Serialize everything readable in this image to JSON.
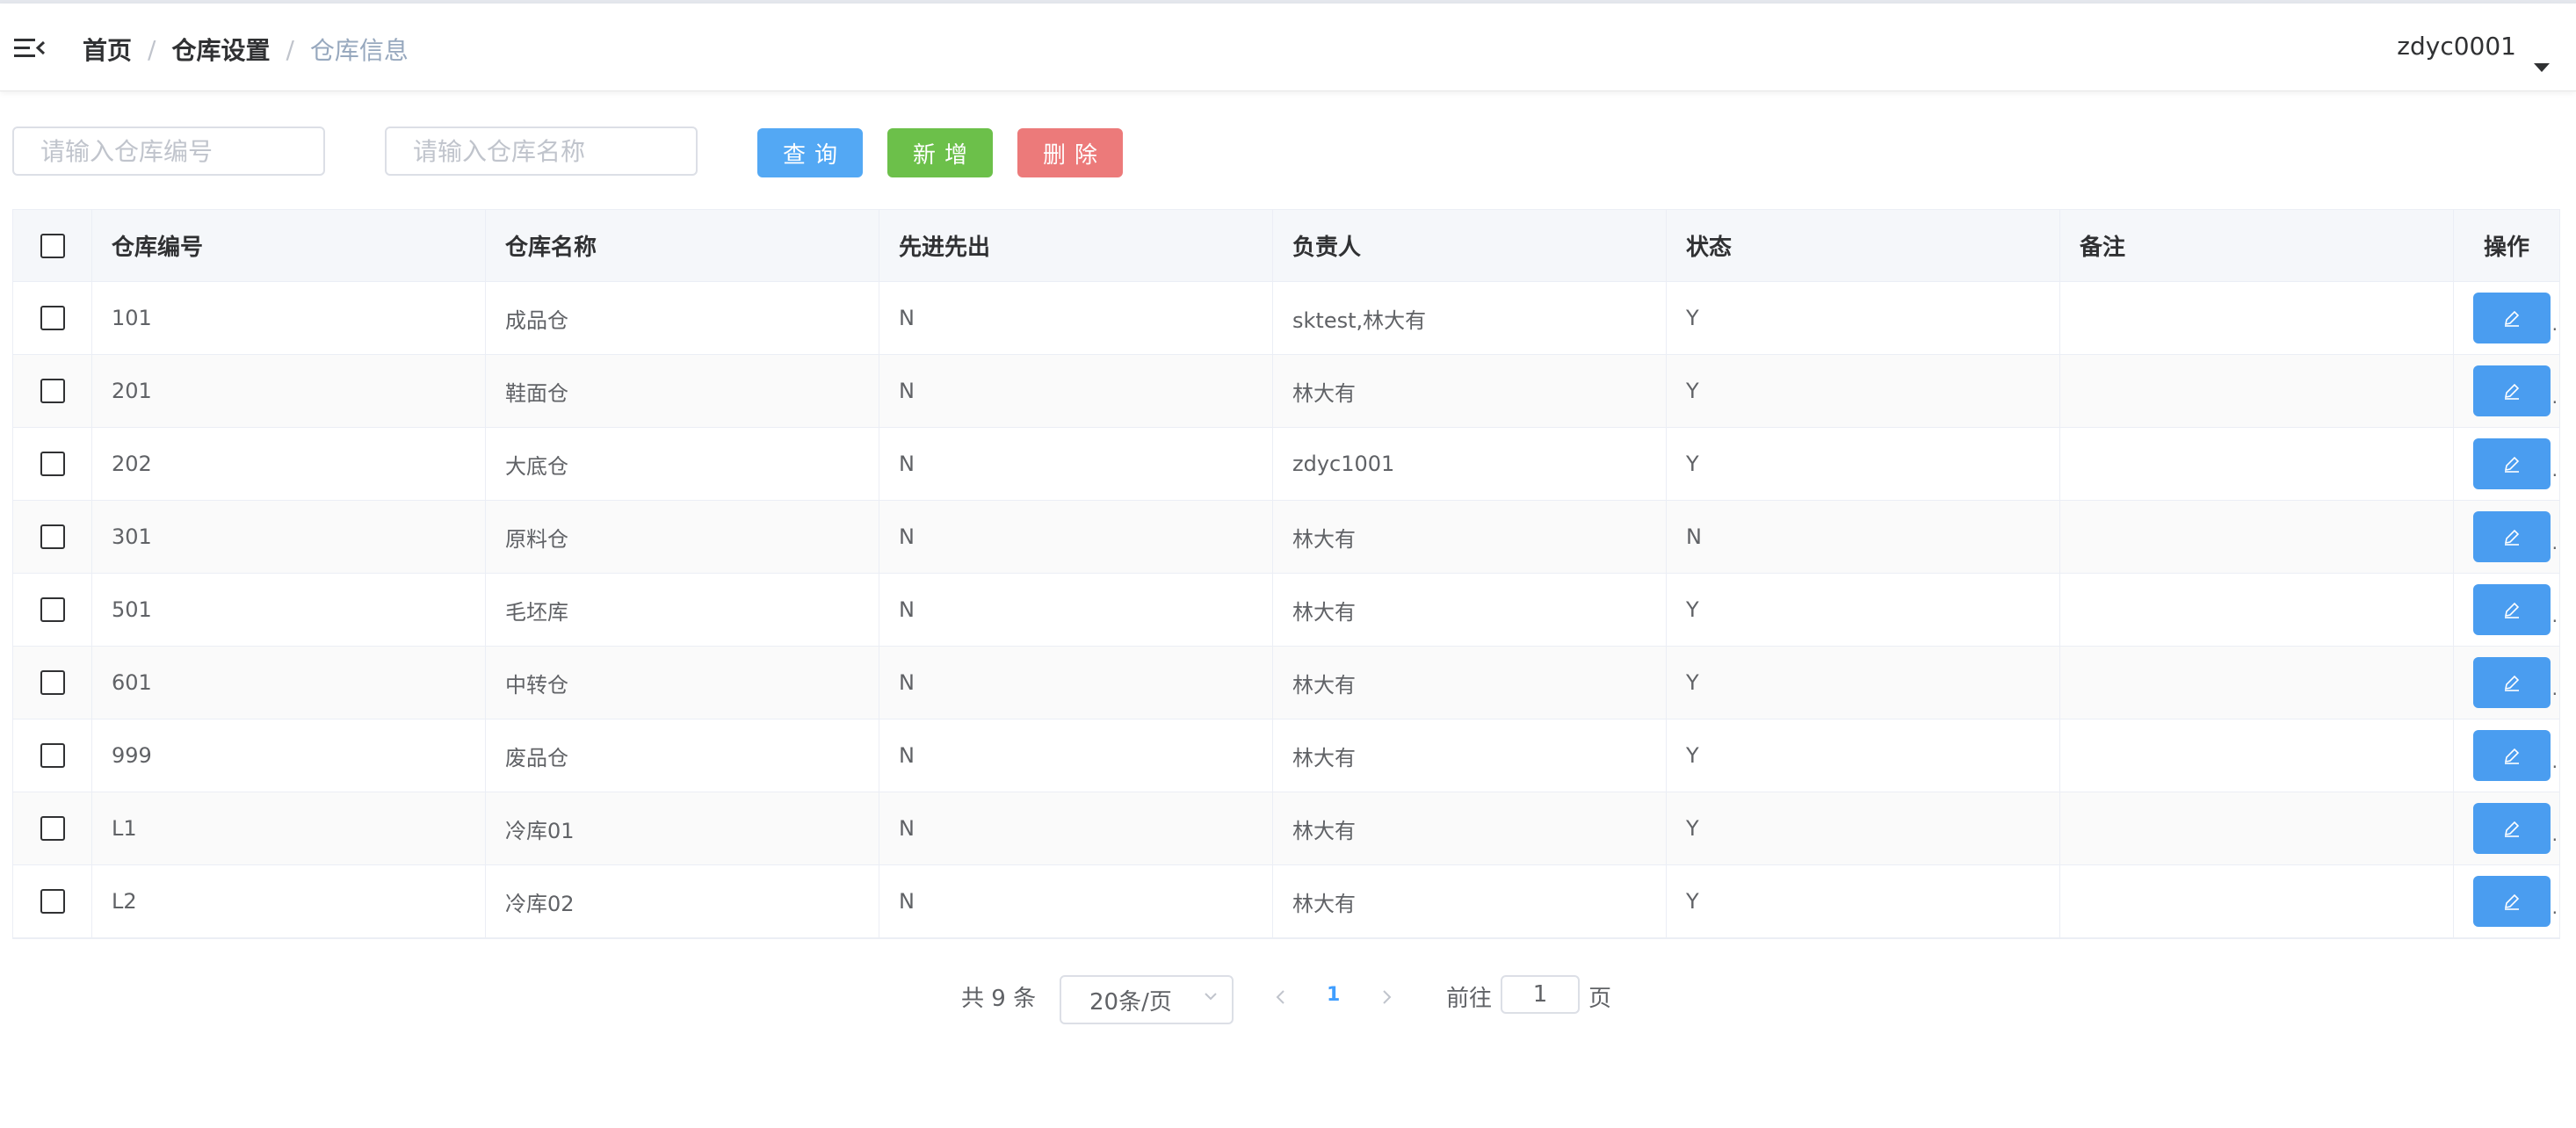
{
  "header": {
    "breadcrumb": [
      "首页",
      "仓库设置",
      "仓库信息"
    ],
    "username": "zdyc0001"
  },
  "toolbar": {
    "code_placeholder": "请输入仓库编号",
    "name_placeholder": "请输入仓库名称",
    "query_label": "查询",
    "add_label": "新增",
    "delete_label": "删除"
  },
  "table": {
    "columns": [
      "仓库编号",
      "仓库名称",
      "先进先出",
      "负责人",
      "状态",
      "备注",
      "操作"
    ],
    "rows": [
      [
        "101",
        "成品仓",
        "N",
        "sktest,林大有",
        "Y",
        ""
      ],
      [
        "201",
        "鞋面仓",
        "N",
        "林大有",
        "Y",
        ""
      ],
      [
        "202",
        "大底仓",
        "N",
        "zdyc1001",
        "Y",
        ""
      ],
      [
        "301",
        "原料仓",
        "N",
        "林大有",
        "N",
        ""
      ],
      [
        "501",
        "毛坯库",
        "N",
        "林大有",
        "Y",
        ""
      ],
      [
        "601",
        "中转仓",
        "N",
        "林大有",
        "Y",
        ""
      ],
      [
        "999",
        "废品仓",
        "N",
        "林大有",
        "Y",
        ""
      ],
      [
        "L1",
        "冷库01",
        "N",
        "林大有",
        "Y",
        ""
      ],
      [
        "L2",
        "冷库02",
        "N",
        "林大有",
        "Y",
        ""
      ]
    ]
  },
  "pagination": {
    "total_text": "共 9 条",
    "page_size": "20条/页",
    "current_page": "1",
    "goto_prefix": "前往",
    "goto_value": "1",
    "goto_suffix": "页"
  },
  "colors": {
    "query": "#53a8f4",
    "add": "#6cc04a",
    "delete": "#ec7a7a",
    "edit": "#4a9df0",
    "active_page": "#409eff"
  }
}
